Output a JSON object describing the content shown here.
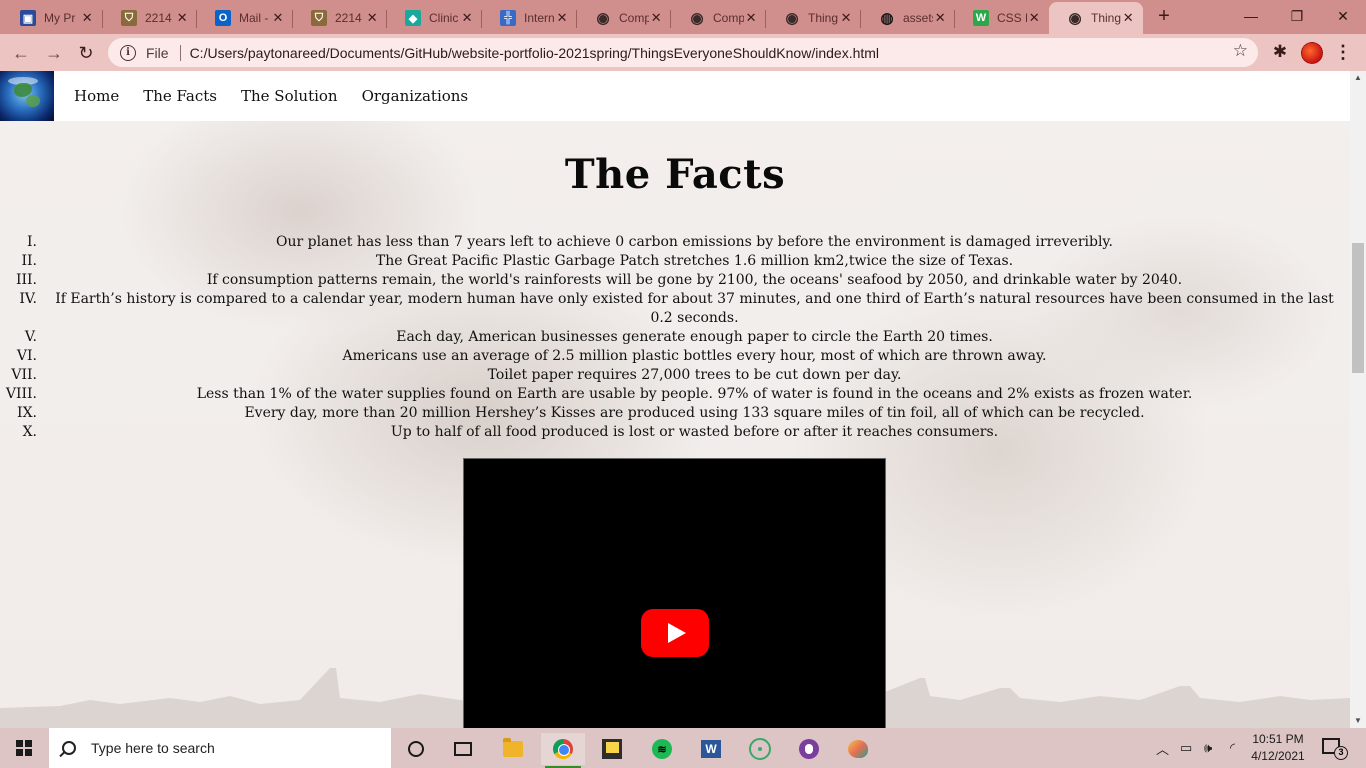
{
  "browser": {
    "tabs": [
      {
        "title": "My Pr",
        "icon": "profile-icon",
        "color": "#2b4a9a",
        "active": false
      },
      {
        "title": "2214",
        "icon": "university-crest-icon",
        "color": "#8a6a3a",
        "active": false
      },
      {
        "title": "Mail -",
        "icon": "outlook-icon",
        "color": "#0a64c8",
        "active": false
      },
      {
        "title": "2214",
        "icon": "university-crest-icon",
        "color": "#8a6a3a",
        "active": false
      },
      {
        "title": "Clinic",
        "icon": "diamond-icon",
        "color": "#1aa89a",
        "active": false
      },
      {
        "title": "Intern",
        "icon": "chart-icon",
        "color": "#3a6ac8",
        "active": false
      },
      {
        "title": "Comp",
        "icon": "globe-icon",
        "color": "#3a2a2a",
        "active": false
      },
      {
        "title": "Comp",
        "icon": "globe-icon",
        "color": "#3a2a2a",
        "active": false
      },
      {
        "title": "Thing",
        "icon": "globe-icon",
        "color": "#3a2a2a",
        "active": false
      },
      {
        "title": "assets",
        "icon": "github-icon",
        "color": "#1a1a1a",
        "active": false
      },
      {
        "title": "CSS F",
        "icon": "w3schools-icon",
        "color": "#2aa84a",
        "active": false
      },
      {
        "title": "Thing",
        "icon": "globe-icon",
        "color": "#3a2a2a",
        "active": true
      }
    ],
    "new_tab": "+",
    "controls": {
      "minimize": "—",
      "maximize": "❐",
      "close": "✕"
    },
    "address": {
      "scheme": "File",
      "url": "C:/Users/paytonareed/Documents/GitHub/website-portfolio-2021spring/ThingsEveryoneShouldKnow/index.html"
    }
  },
  "site": {
    "nav": [
      "Home",
      "The Facts",
      "The Solution",
      "Organizations"
    ],
    "heading": "The Facts",
    "facts": [
      {
        "num": "I.",
        "text": "Our planet has less than 7 years left to achieve 0 carbon emissions by before the environment is damaged irreveribly."
      },
      {
        "num": "II.",
        "text": "The Great Pacific Plastic Garbage Patch stretches 1.6 million km2,twice the size of Texas."
      },
      {
        "num": "III.",
        "text": "If consumption patterns remain, the world's rainforests will be gone by 2100, the oceans' seafood by 2050, and drinkable water by 2040."
      },
      {
        "num": "IV.",
        "text": "If Earth’s history is compared to a calendar year, modern human have only existed for about 37 minutes, and one third of Earth’s natural resources have been consumed in the last 0.2 seconds."
      },
      {
        "num": "V.",
        "text": "Each day, American businesses generate enough paper to circle the Earth 20 times."
      },
      {
        "num": "VI.",
        "text": "Americans use an average of 2.5 million plastic bottles every hour, most of which are thrown away."
      },
      {
        "num": "VII.",
        "text": "Toilet paper requires 27,000 trees to be cut down per day."
      },
      {
        "num": "VIII.",
        "text": "Less than 1% of the water supplies found on Earth are usable by people. 97% of water is found in the oceans and 2% exists as frozen water."
      },
      {
        "num": "IX.",
        "text": "Every day, more than 20 million Hershey’s Kisses are produced using 133 square miles of tin foil, all of which can be recycled."
      },
      {
        "num": "X.",
        "text": "Up to half of all food produced is lost or wasted before or after it reaches consumers."
      }
    ]
  },
  "taskbar": {
    "search_placeholder": "Type here to search",
    "time": "10:51 PM",
    "date": "4/12/2021",
    "notification_count": "3"
  }
}
